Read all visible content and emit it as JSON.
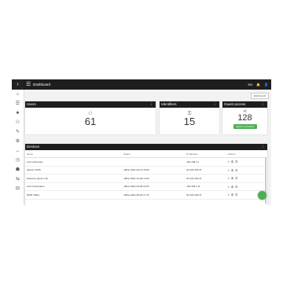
{
  "sidebar": {
    "toggle": "›",
    "items": [
      "⌂",
      "☰",
      "♣",
      "⚇",
      "✎",
      "⚙",
      "↔",
      "◷",
      "☗",
      "⇆",
      "⊟",
      "☏"
    ]
  },
  "topbar": {
    "title": "Dashboard",
    "lang": "EN",
    "menu": "☰",
    "bell": "🔔",
    "user": "👤"
  },
  "date_chip": "2023-02-15",
  "cards": {
    "users": {
      "title": "Users",
      "value": "61"
    },
    "identifiers": {
      "title": "Identifiers",
      "value": "15"
    },
    "guest": {
      "title": "Guest access",
      "value": "128",
      "button": "GRANT ACCESS"
    }
  },
  "devices": {
    "title": "Devices",
    "columns": [
      "Name",
      "Status",
      "IP address",
      "Actions"
    ],
    "rows": [
      {
        "name": "Unit 1 Entrance",
        "status": "",
        "ip": "192.168.1.2"
      },
      {
        "name": "Akuvox X915",
        "status": "offline 2021-03-12 15:03",
        "ip": "91.220.103.47"
      },
      {
        "name": "Entrance panel 1.46",
        "status": "offline 2021-12-28 14:03",
        "ip": "91.220.103.47"
      },
      {
        "name": "Unit 6 Doorpanel",
        "status": "offline 2021-03-28 22:03",
        "ip": "192.168.1.11"
      },
      {
        "name": "R20K Office",
        "status": "offline 2021-09-30 17:13",
        "ip": "91.220.103.47"
      }
    ]
  }
}
